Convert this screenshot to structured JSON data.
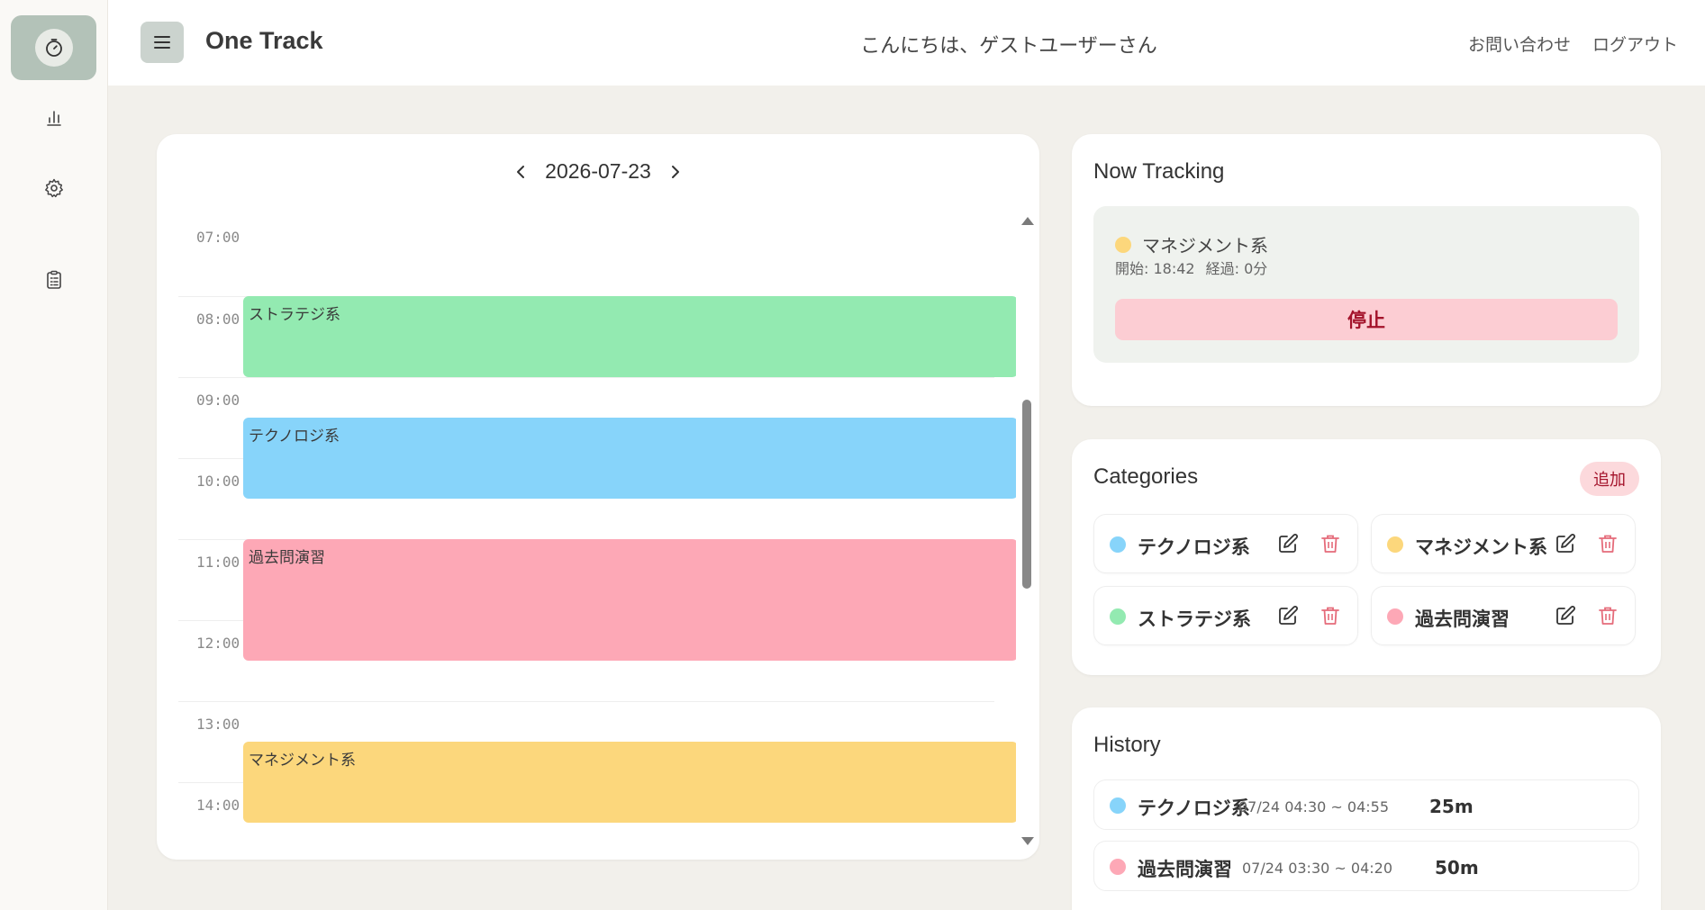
{
  "app": {
    "title": "One Track"
  },
  "header": {
    "greeting": "こんにちは、ゲストユーザーさん",
    "contact": "お問い合わせ",
    "logout": "ログアウト"
  },
  "sidebar": {
    "items": [
      {
        "icon": "timer-icon",
        "active": true
      },
      {
        "icon": "bar-chart-icon",
        "active": false
      },
      {
        "icon": "gear-icon",
        "active": false
      },
      {
        "icon": "clipboard-icon",
        "active": false
      }
    ]
  },
  "calendar": {
    "date": "2026-07-23",
    "hours": [
      "07:00",
      "08:00",
      "09:00",
      "10:00",
      "11:00",
      "12:00",
      "13:00",
      "14:00"
    ],
    "events": [
      {
        "label": "ストラテジ系",
        "color": "#93eab1",
        "start": "08:00",
        "end": "09:00"
      },
      {
        "label": "テクノロジ系",
        "color": "#87d4fa",
        "start": "09:30",
        "end": "10:30"
      },
      {
        "label": "過去問演習",
        "color": "#fda8b6",
        "start": "11:00",
        "end": "12:30"
      },
      {
        "label": "マネジメント系",
        "color": "#fcd77c",
        "start": "13:30",
        "end": "14:30"
      }
    ]
  },
  "tracking": {
    "title": "Now Tracking",
    "category": "マネジメント系",
    "color": "#fcd77c",
    "start_text": "開始: 18:42",
    "elapsed_text": "経過: 0分",
    "stop_label": "停止"
  },
  "categories": {
    "title": "Categories",
    "add_label": "追加",
    "items": [
      {
        "name": "テクノロジ系",
        "color": "#87d4fa"
      },
      {
        "name": "マネジメント系",
        "color": "#fcd77c"
      },
      {
        "name": "ストラテジ系",
        "color": "#93eab1"
      },
      {
        "name": "過去問演習",
        "color": "#fda8b6"
      }
    ]
  },
  "history": {
    "title": "History",
    "items": [
      {
        "name": "テクノロジ系",
        "color": "#87d4fa",
        "time": "07/24 04:30 ~ 04:55",
        "duration": "25m"
      },
      {
        "name": "過去問演習",
        "color": "#fda8b6",
        "time": "07/24 03:30 ~ 04:20",
        "duration": "50m"
      }
    ]
  },
  "colors": {
    "background": "#f2f0eb",
    "active_nav": "#b3c2b8",
    "stop_button": "#fccdd3",
    "delete_icon": "#e56b7a"
  }
}
